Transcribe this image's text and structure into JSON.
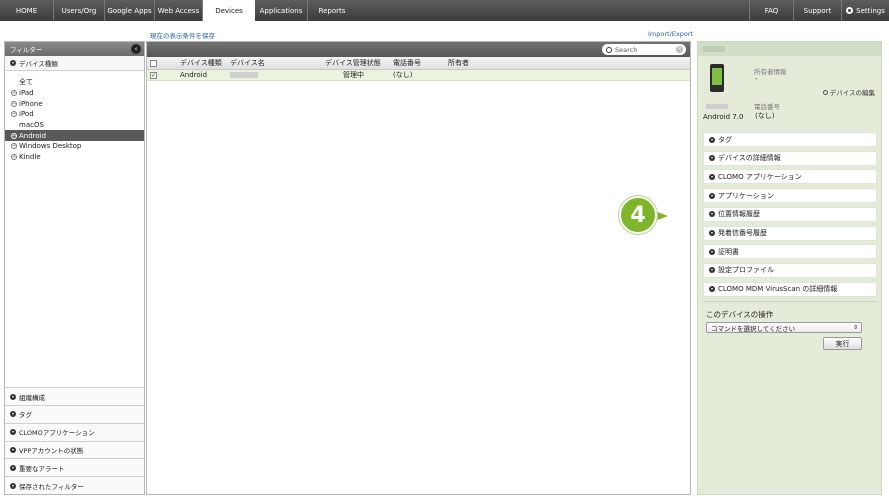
{
  "nav": {
    "tabs": [
      "HOME",
      "Users/Org",
      "Google Apps",
      "Web Access",
      "Devices",
      "Applications",
      "Reports"
    ],
    "active": "Devices",
    "right": [
      "FAQ",
      "Support",
      "Settings"
    ]
  },
  "subbar": {
    "save_filter": "現在の表示条件を保存",
    "import_export": "Import/Export"
  },
  "sidebar": {
    "header": "フィルター",
    "device_type_header": "デバイス種類",
    "device_types": [
      {
        "label": "全て",
        "expandable": false,
        "selected": false
      },
      {
        "label": "iPad",
        "expandable": true,
        "selected": false
      },
      {
        "label": "iPhone",
        "expandable": true,
        "selected": false
      },
      {
        "label": "iPod",
        "expandable": true,
        "selected": false
      },
      {
        "label": "macOS",
        "expandable": false,
        "selected": false
      },
      {
        "label": "Android",
        "expandable": true,
        "selected": true
      },
      {
        "label": "Windows Desktop",
        "expandable": true,
        "selected": false
      },
      {
        "label": "Kindle",
        "expandable": true,
        "selected": false
      }
    ],
    "bottom_sections": [
      "組織構成",
      "タグ",
      "CLOMOアプリケーション",
      "VPPアカウントの状態",
      "重要なアラート",
      "保存されたフィルター"
    ]
  },
  "search": {
    "placeholder": "Search"
  },
  "table": {
    "columns": [
      "デバイス種類",
      "デバイス名",
      "デバイス管理状態",
      "電話番号",
      "所有者"
    ],
    "rows": [
      {
        "checked": true,
        "type": "Android",
        "name": "",
        "status": "管理中",
        "phone": "(なし)",
        "owner": ""
      }
    ]
  },
  "detail": {
    "owner_label": "所有者情報",
    "owner_value": "-",
    "edit_link": "デバイスの編集",
    "phone_label": "電話番号",
    "phone_value": "(なし)",
    "os": "Android 7.0",
    "sections": [
      "タグ",
      "デバイスの詳細情報",
      "CLOMO アプリケーション",
      "アプリケーション",
      "位置情報履歴",
      "発着信番号履歴",
      "証明書",
      "設定プロファイル",
      "CLOMO MDM VirusScan の詳細情報"
    ],
    "operation_title": "このデバイスの操作",
    "command_select": "コマンドを選択してください",
    "run_button": "実行"
  },
  "step_badge": "4",
  "colors": {
    "badge": "#7fb52a",
    "right_panel": "#e4ecd9",
    "selected_row": "#e9f3df"
  }
}
